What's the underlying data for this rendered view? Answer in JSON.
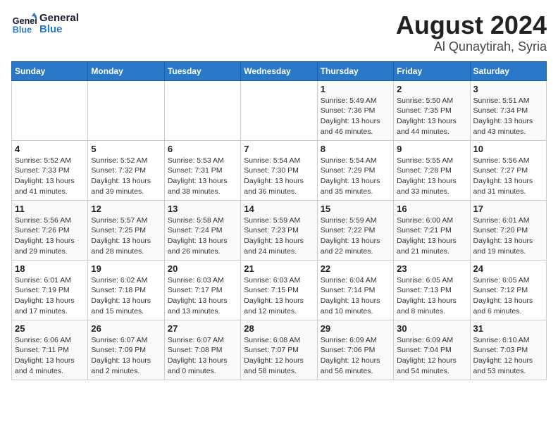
{
  "header": {
    "logo_line1": "General",
    "logo_line2": "Blue",
    "main_title": "August 2024",
    "sub_title": "Al Qunaytirah, Syria"
  },
  "days_of_week": [
    "Sunday",
    "Monday",
    "Tuesday",
    "Wednesday",
    "Thursday",
    "Friday",
    "Saturday"
  ],
  "weeks": [
    [
      {
        "day": "",
        "info": ""
      },
      {
        "day": "",
        "info": ""
      },
      {
        "day": "",
        "info": ""
      },
      {
        "day": "",
        "info": ""
      },
      {
        "day": "1",
        "info": "Sunrise: 5:49 AM\nSunset: 7:36 PM\nDaylight: 13 hours\nand 46 minutes."
      },
      {
        "day": "2",
        "info": "Sunrise: 5:50 AM\nSunset: 7:35 PM\nDaylight: 13 hours\nand 44 minutes."
      },
      {
        "day": "3",
        "info": "Sunrise: 5:51 AM\nSunset: 7:34 PM\nDaylight: 13 hours\nand 43 minutes."
      }
    ],
    [
      {
        "day": "4",
        "info": "Sunrise: 5:52 AM\nSunset: 7:33 PM\nDaylight: 13 hours\nand 41 minutes."
      },
      {
        "day": "5",
        "info": "Sunrise: 5:52 AM\nSunset: 7:32 PM\nDaylight: 13 hours\nand 39 minutes."
      },
      {
        "day": "6",
        "info": "Sunrise: 5:53 AM\nSunset: 7:31 PM\nDaylight: 13 hours\nand 38 minutes."
      },
      {
        "day": "7",
        "info": "Sunrise: 5:54 AM\nSunset: 7:30 PM\nDaylight: 13 hours\nand 36 minutes."
      },
      {
        "day": "8",
        "info": "Sunrise: 5:54 AM\nSunset: 7:29 PM\nDaylight: 13 hours\nand 35 minutes."
      },
      {
        "day": "9",
        "info": "Sunrise: 5:55 AM\nSunset: 7:28 PM\nDaylight: 13 hours\nand 33 minutes."
      },
      {
        "day": "10",
        "info": "Sunrise: 5:56 AM\nSunset: 7:27 PM\nDaylight: 13 hours\nand 31 minutes."
      }
    ],
    [
      {
        "day": "11",
        "info": "Sunrise: 5:56 AM\nSunset: 7:26 PM\nDaylight: 13 hours\nand 29 minutes."
      },
      {
        "day": "12",
        "info": "Sunrise: 5:57 AM\nSunset: 7:25 PM\nDaylight: 13 hours\nand 28 minutes."
      },
      {
        "day": "13",
        "info": "Sunrise: 5:58 AM\nSunset: 7:24 PM\nDaylight: 13 hours\nand 26 minutes."
      },
      {
        "day": "14",
        "info": "Sunrise: 5:59 AM\nSunset: 7:23 PM\nDaylight: 13 hours\nand 24 minutes."
      },
      {
        "day": "15",
        "info": "Sunrise: 5:59 AM\nSunset: 7:22 PM\nDaylight: 13 hours\nand 22 minutes."
      },
      {
        "day": "16",
        "info": "Sunrise: 6:00 AM\nSunset: 7:21 PM\nDaylight: 13 hours\nand 21 minutes."
      },
      {
        "day": "17",
        "info": "Sunrise: 6:01 AM\nSunset: 7:20 PM\nDaylight: 13 hours\nand 19 minutes."
      }
    ],
    [
      {
        "day": "18",
        "info": "Sunrise: 6:01 AM\nSunset: 7:19 PM\nDaylight: 13 hours\nand 17 minutes."
      },
      {
        "day": "19",
        "info": "Sunrise: 6:02 AM\nSunset: 7:18 PM\nDaylight: 13 hours\nand 15 minutes."
      },
      {
        "day": "20",
        "info": "Sunrise: 6:03 AM\nSunset: 7:17 PM\nDaylight: 13 hours\nand 13 minutes."
      },
      {
        "day": "21",
        "info": "Sunrise: 6:03 AM\nSunset: 7:15 PM\nDaylight: 13 hours\nand 12 minutes."
      },
      {
        "day": "22",
        "info": "Sunrise: 6:04 AM\nSunset: 7:14 PM\nDaylight: 13 hours\nand 10 minutes."
      },
      {
        "day": "23",
        "info": "Sunrise: 6:05 AM\nSunset: 7:13 PM\nDaylight: 13 hours\nand 8 minutes."
      },
      {
        "day": "24",
        "info": "Sunrise: 6:05 AM\nSunset: 7:12 PM\nDaylight: 13 hours\nand 6 minutes."
      }
    ],
    [
      {
        "day": "25",
        "info": "Sunrise: 6:06 AM\nSunset: 7:11 PM\nDaylight: 13 hours\nand 4 minutes."
      },
      {
        "day": "26",
        "info": "Sunrise: 6:07 AM\nSunset: 7:09 PM\nDaylight: 13 hours\nand 2 minutes."
      },
      {
        "day": "27",
        "info": "Sunrise: 6:07 AM\nSunset: 7:08 PM\nDaylight: 13 hours\nand 0 minutes."
      },
      {
        "day": "28",
        "info": "Sunrise: 6:08 AM\nSunset: 7:07 PM\nDaylight: 12 hours\nand 58 minutes."
      },
      {
        "day": "29",
        "info": "Sunrise: 6:09 AM\nSunset: 7:06 PM\nDaylight: 12 hours\nand 56 minutes."
      },
      {
        "day": "30",
        "info": "Sunrise: 6:09 AM\nSunset: 7:04 PM\nDaylight: 12 hours\nand 54 minutes."
      },
      {
        "day": "31",
        "info": "Sunrise: 6:10 AM\nSunset: 7:03 PM\nDaylight: 12 hours\nand 53 minutes."
      }
    ]
  ]
}
